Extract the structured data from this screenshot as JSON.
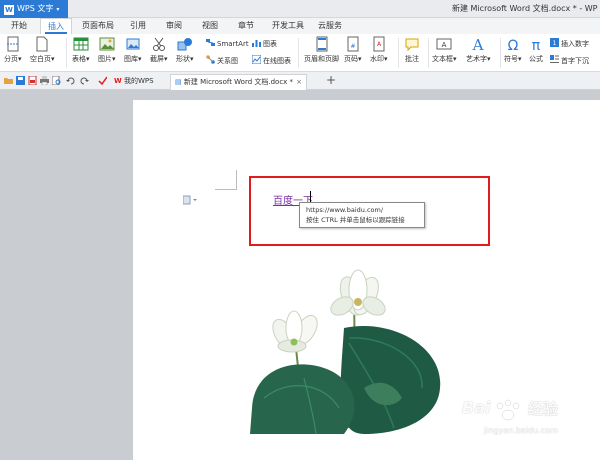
{
  "app": {
    "name": "WPS 文字",
    "window_title": "新建 Microsoft Word 文档.docx * - WP"
  },
  "menu": {
    "tabs": [
      "开始",
      "插入",
      "页面布局",
      "引用",
      "审阅",
      "视图",
      "章节",
      "开发工具",
      "云服务"
    ],
    "active": "插入"
  },
  "ribbon": {
    "page_break": "分页",
    "blank_page": "空白页",
    "table": "表格",
    "picture": "图片",
    "gallery": "图库",
    "screenshot": "截屏",
    "shape": "形状",
    "smartart": "SmartArt",
    "chart": "图表",
    "relation_chart": "关系图",
    "online_chart": "在线图表",
    "header_footer": "页眉和页脚",
    "page_number": "页码",
    "watermark": "水印",
    "comment": "批注",
    "textbox": "文本框",
    "wordart": "艺术字",
    "symbol": "符号",
    "formula": "公式",
    "insert_number": "插入数字",
    "dropcap": "首字下沉"
  },
  "tabbar": {
    "my_wps": "我的WPS",
    "doc_tab": "新建 Microsoft Word 文档.docx *",
    "close": "×",
    "new_tab": "+"
  },
  "document": {
    "link_text": "百度一下",
    "tooltip_line1": "https://www.baidu.com/",
    "tooltip_line2": "按住 CTRL 并单击鼠标以跟踪链接"
  },
  "watermark": {
    "brand": "Bai",
    "brand2": "经验",
    "url": "jingyan.baidu.com"
  },
  "colors": {
    "accent": "#2b7bd6",
    "highlight": "#e31b1b",
    "link": "#7a2fa3"
  }
}
